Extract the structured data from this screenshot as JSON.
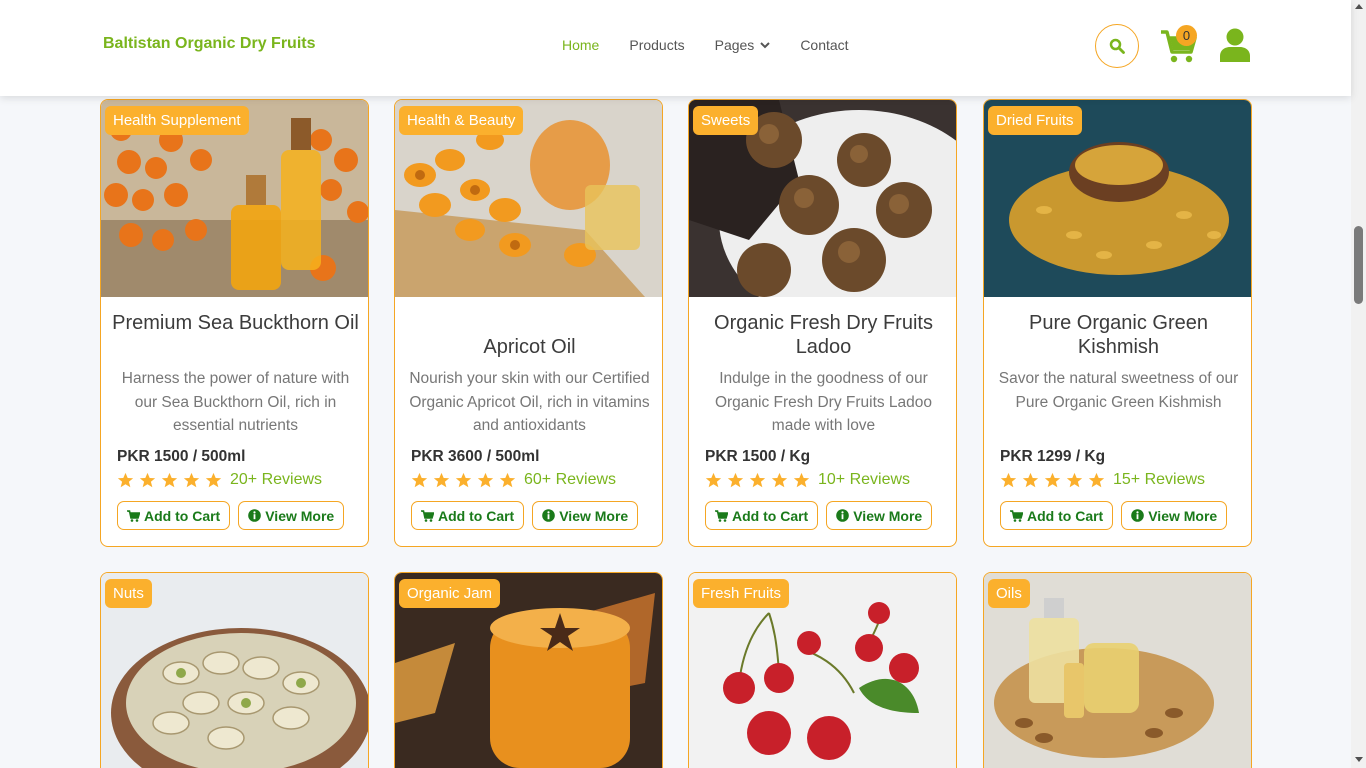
{
  "brand": "Baltistan Organic Dry Fruits",
  "nav": {
    "home": "Home",
    "products": "Products",
    "pages": "Pages",
    "contact": "Contact"
  },
  "cart_count": "0",
  "colors": {
    "accent": "#7ab51d",
    "orange": "#f5a623",
    "button_text": "#1a7a1a"
  },
  "icons": [
    "search-icon",
    "cart-icon",
    "user-icon",
    "chevron-down-icon",
    "star-icon",
    "info-icon"
  ],
  "buttons": {
    "add_to_cart": "Add to Cart",
    "view_more": "View More"
  },
  "products": [
    {
      "badge": "Health Supplement",
      "title": "Premium Sea Buckthorn Oil",
      "description": "Harness the power of nature with our Sea Buckthorn Oil, rich in essential nutrients",
      "price": "PKR 1500 / 500ml",
      "rating": 5,
      "reviews": "20+ Reviews"
    },
    {
      "badge": "Health & Beauty",
      "title": "Apricot Oil",
      "description": "Nourish your skin with our Certified Organic Apricot Oil, rich in vitamins and antioxidants",
      "price": "PKR 3600 / 500ml",
      "rating": 5,
      "reviews": "60+ Reviews"
    },
    {
      "badge": "Sweets",
      "title": "Organic Fresh Dry Fruits Ladoo",
      "description": "Indulge in the goodness of our Organic Fresh Dry Fruits Ladoo made with love",
      "price": "PKR 1500 / Kg",
      "rating": 5,
      "reviews": "10+ Reviews"
    },
    {
      "badge": "Dried Fruits",
      "title": "Pure Organic Green Kishmish",
      "description": "Savor the natural sweetness of our Pure Organic Green Kishmish",
      "price": "PKR 1299 / Kg",
      "rating": 5,
      "reviews": "15+ Reviews"
    },
    {
      "badge": "Nuts"
    },
    {
      "badge": "Organic Jam"
    },
    {
      "badge": "Fresh Fruits"
    },
    {
      "badge": "Oils"
    }
  ]
}
